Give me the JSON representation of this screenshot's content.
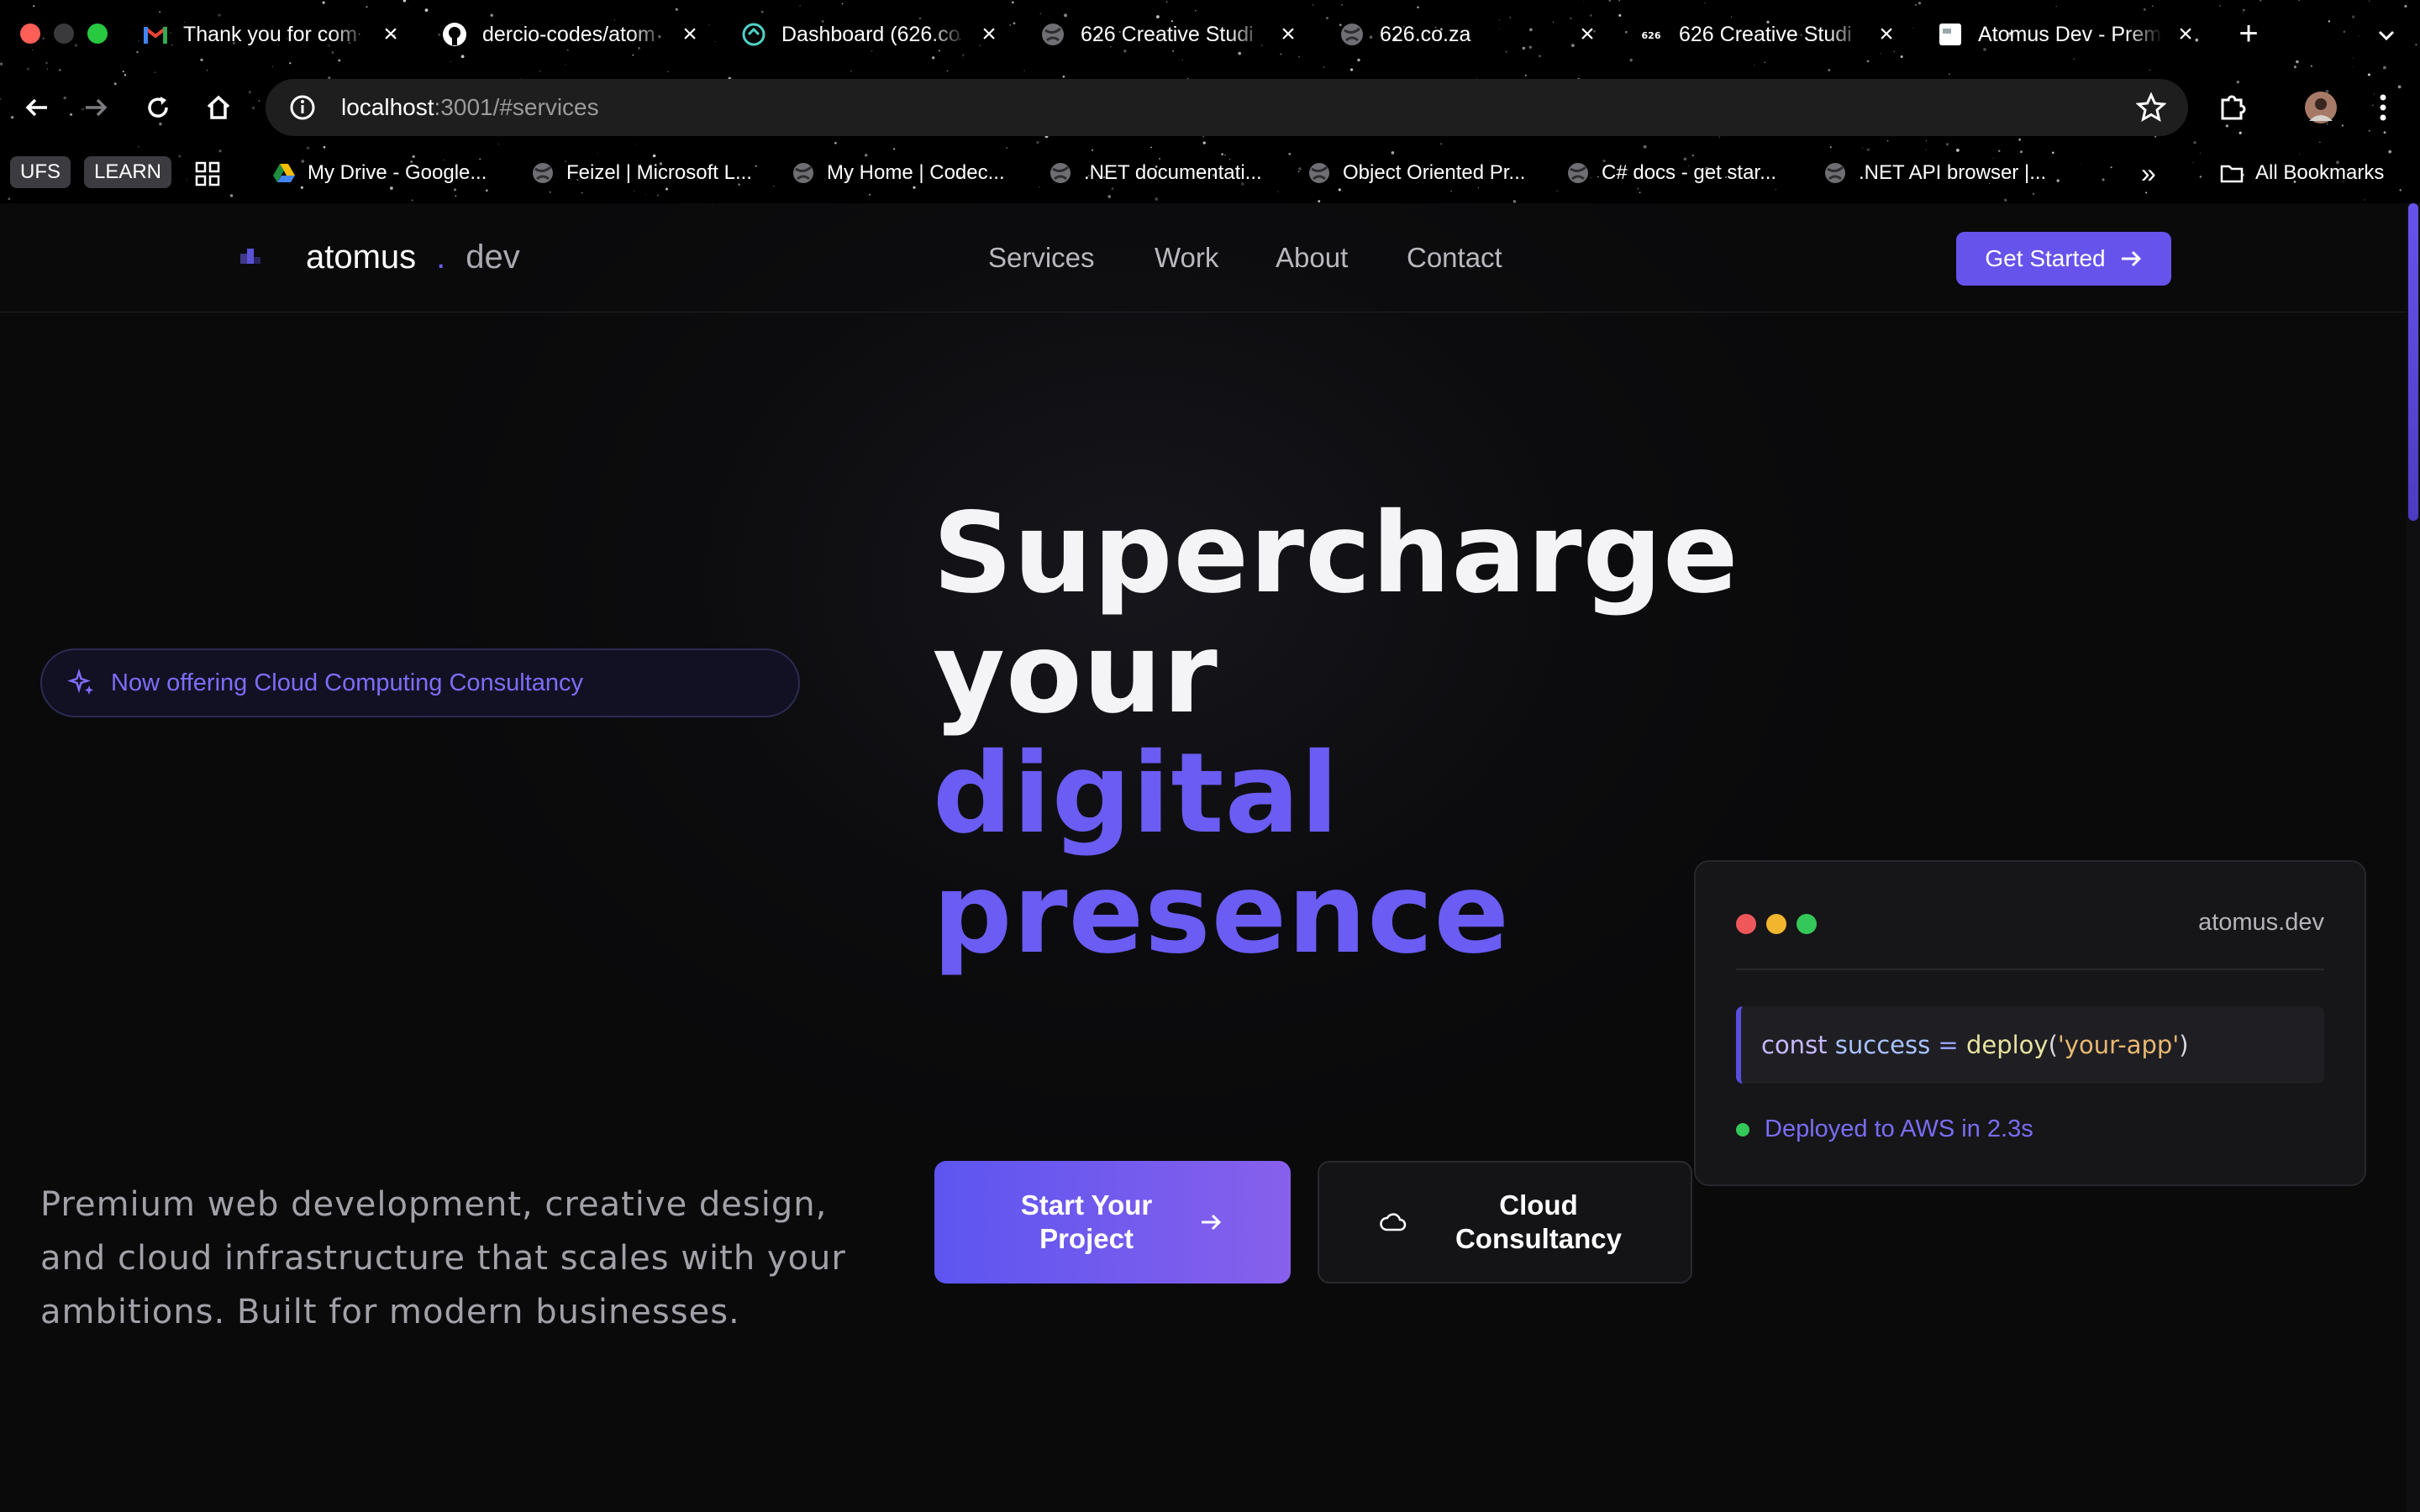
{
  "browser": {
    "tabs": [
      {
        "title": "Thank you for com",
        "icon": "gmail-icon"
      },
      {
        "title": "dercio-codes/atom",
        "icon": "github-icon"
      },
      {
        "title": "Dashboard (626.co",
        "icon": "netlify-icon"
      },
      {
        "title": "626 Creative Studi",
        "icon": "globe-icon"
      },
      {
        "title": "626.co.za",
        "icon": "globe-icon"
      },
      {
        "title": "626 Creative Studi",
        "icon": "626-icon"
      },
      {
        "title": "Atomus Dev - Prem",
        "icon": "page-icon"
      }
    ],
    "new_tab_label": "+",
    "url_host": "localhost",
    "url_rest": ":3001/#services",
    "bookmarks": [
      "My Drive - Google...",
      "Feizel | Microsoft L...",
      "My Home | Codec...",
      ".NET documentati...",
      "Object Oriented Pr...",
      "C# docs - get star...",
      ".NET API browser |..."
    ],
    "bookmark_tags": [
      "UFS",
      "LEARN"
    ],
    "more_bookmarks": "»",
    "all_bookmarks": "All Bookmarks"
  },
  "site": {
    "logo": {
      "name": "atomus",
      "dot": ".",
      "tld": "dev"
    },
    "nav": [
      "Services",
      "Work",
      "About",
      "Contact"
    ],
    "cta": "Get Started",
    "badge": "Now offering Cloud Computing Consultancy",
    "headline": {
      "line1": "Supercharge",
      "line2": "your",
      "line3": "digital",
      "line4": "presence"
    },
    "lede": "Premium web development, creative design, and cloud infrastructure that scales with your ambitions. Built for modern businesses.",
    "primary_button": "Start Your Project",
    "secondary_button": "Cloud Consultancy",
    "card": {
      "domain": "atomus.dev",
      "code": {
        "kw": "const",
        "var": "success",
        "op": "=",
        "fn": "deploy",
        "open": "(",
        "str": "'your-app'",
        "close": ")"
      },
      "status": "Deployed to AWS in 2.3s"
    }
  },
  "colors": {
    "accent": "#6653ec",
    "headline_purple": "#6b5cf3",
    "status_green": "#34c759"
  }
}
